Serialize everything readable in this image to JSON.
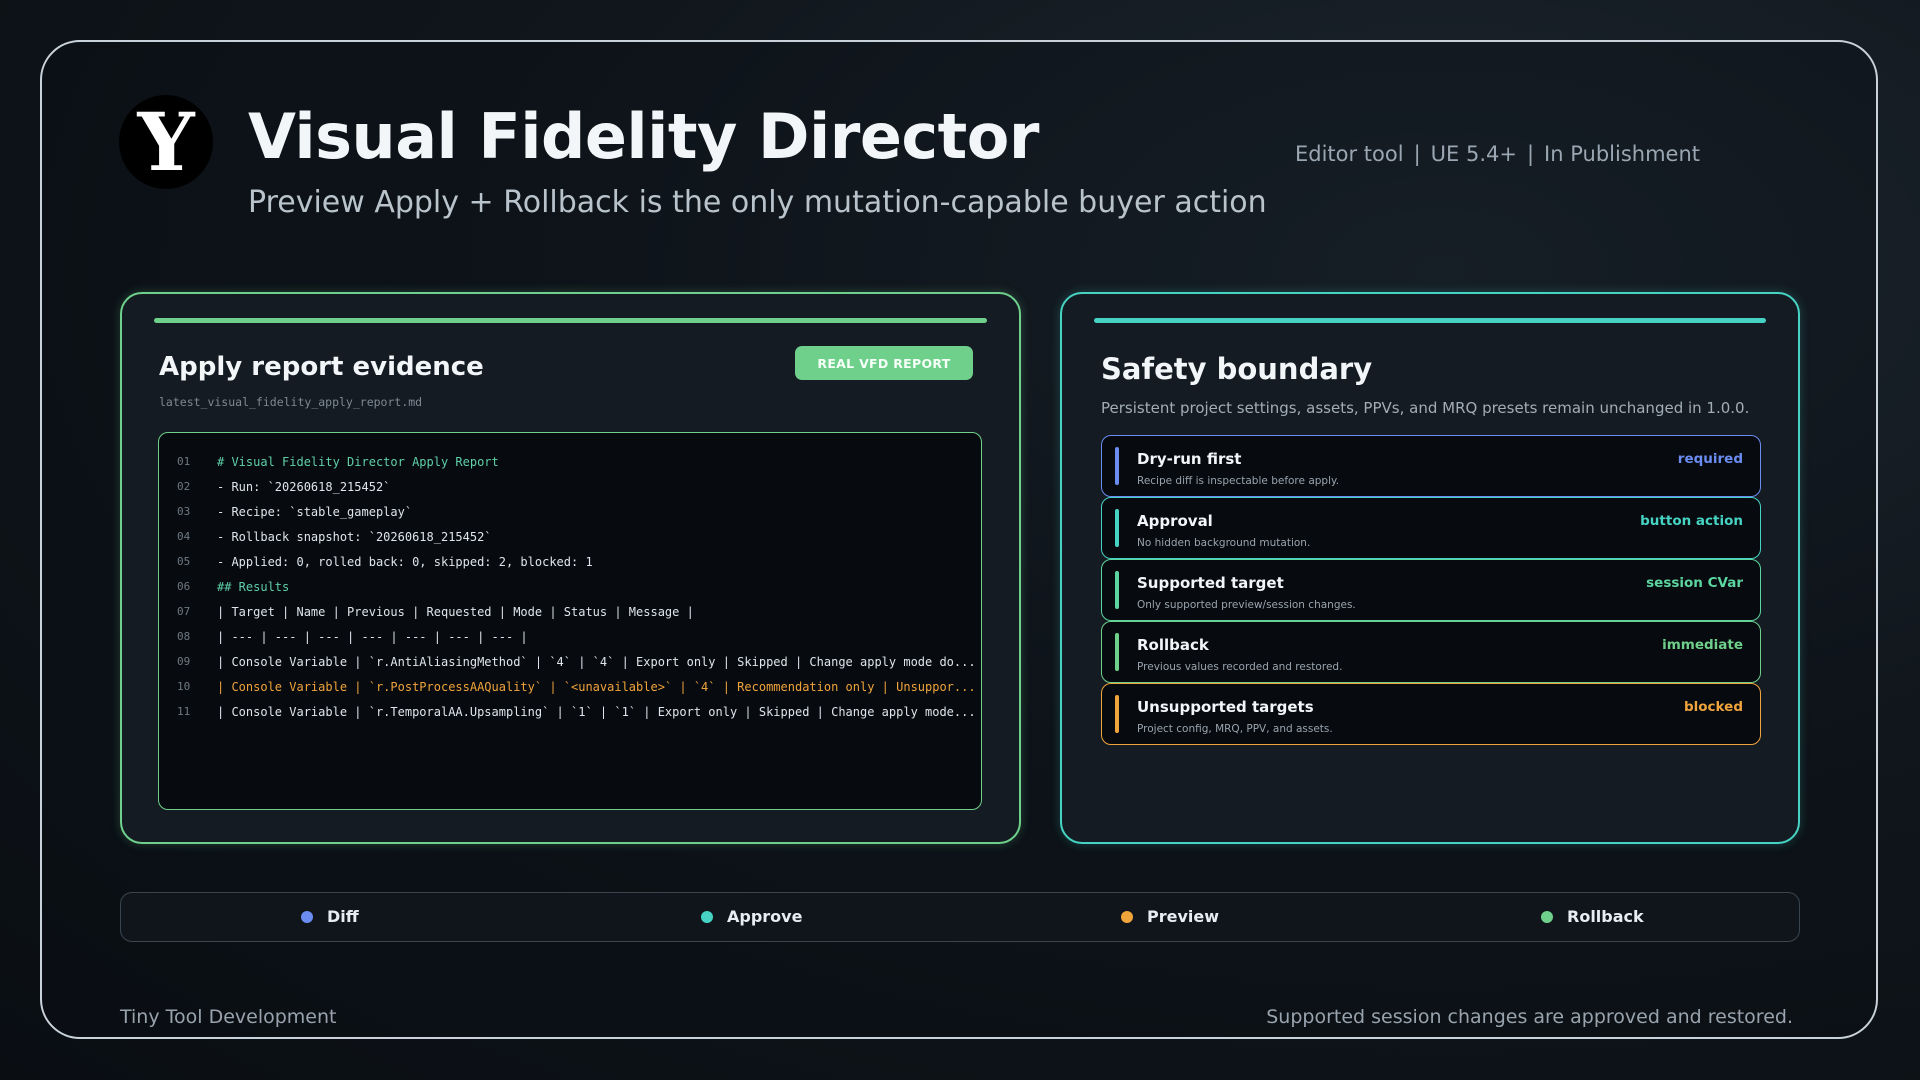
{
  "header": {
    "logo_letter": "Y",
    "title": "Visual Fidelity Director",
    "subtitle": "Preview Apply + Rollback is the only mutation-capable buyer action",
    "meta": [
      "Editor tool",
      "UE 5.4+",
      "In Publishment"
    ]
  },
  "apply_panel": {
    "title": "Apply report evidence",
    "filename": "latest_visual_fidelity_apply_report.md",
    "badge": "REAL VFD REPORT",
    "lines": [
      {
        "num": "01",
        "text": "# Visual Fidelity Director Apply Report",
        "style": "heading"
      },
      {
        "num": "02",
        "text": "- Run: `20260618_215452`",
        "style": "normal"
      },
      {
        "num": "03",
        "text": "- Recipe: `stable_gameplay`",
        "style": "normal"
      },
      {
        "num": "04",
        "text": "- Rollback snapshot: `20260618_215452`",
        "style": "normal"
      },
      {
        "num": "05",
        "text": "- Applied: 0, rolled back: 0, skipped: 2, blocked: 1",
        "style": "normal"
      },
      {
        "num": "06",
        "text": "## Results",
        "style": "heading"
      },
      {
        "num": "07",
        "text": "| Target | Name | Previous | Requested | Mode | Status | Message |",
        "style": "normal"
      },
      {
        "num": "08",
        "text": "| --- | --- | --- | --- | --- | --- | --- |",
        "style": "normal"
      },
      {
        "num": "09",
        "text": "| Console Variable | `r.AntiAliasingMethod` | `4` | `4` | Export only | Skipped | Change apply mode do...",
        "style": "normal"
      },
      {
        "num": "10",
        "text": "| Console Variable | `r.PostProcessAAQuality` | `<unavailable>` | `4` | Recommendation only | Unsuppor...",
        "style": "warn"
      },
      {
        "num": "11",
        "text": "| Console Variable | `r.TemporalAA.Upsampling` | `1` | `1` | Export only | Skipped | Change apply mode...",
        "style": "normal"
      }
    ]
  },
  "safety_panel": {
    "title": "Safety boundary",
    "description": "Persistent project settings, assets, PPVs, and MRQ presets remain unchanged in 1.0.0.",
    "rules": [
      {
        "title": "Dry-run first",
        "desc": "Recipe diff is inspectable before apply.",
        "tag": "required",
        "color": "#6b8cf0"
      },
      {
        "title": "Approval",
        "desc": "No hidden background mutation.",
        "tag": "button action",
        "color": "#46d3c3"
      },
      {
        "title": "Supported target",
        "desc": "Only supported preview/session changes.",
        "tag": "session CVar",
        "color": "#5cd6a0"
      },
      {
        "title": "Rollback",
        "desc": "Previous values recorded and restored.",
        "tag": "immediate",
        "color": "#6fd08c"
      },
      {
        "title": "Unsupported targets",
        "desc": "Project config, MRQ, PPV, and assets.",
        "tag": "blocked",
        "color": "#f0a43c"
      }
    ]
  },
  "legend": [
    {
      "label": "Diff",
      "color": "#6b8cf0"
    },
    {
      "label": "Approve",
      "color": "#46d3c3"
    },
    {
      "label": "Preview",
      "color": "#f0a43c"
    },
    {
      "label": "Rollback",
      "color": "#6fd08c"
    }
  ],
  "footer": {
    "left": "Tiny Tool Development",
    "right": "Supported session changes are approved and restored."
  }
}
